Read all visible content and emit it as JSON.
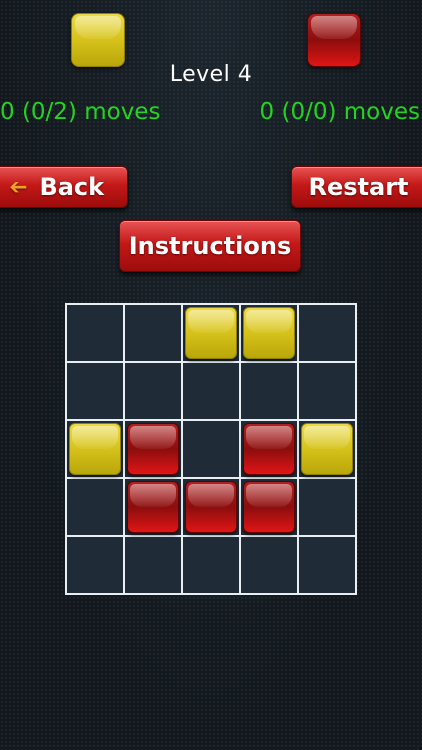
{
  "players": {
    "yellow_color": "#d6c21a",
    "red_color": "#b01212",
    "yellow_moves": "0 (0/2) moves",
    "red_moves": "0 (0/0) moves"
  },
  "level": "Level 4",
  "buttons": {
    "back": "Back",
    "back_icon": "left-arrow-icon",
    "restart": "Restart",
    "instructions": "Instructions"
  },
  "board": {
    "rows": 5,
    "cols": 5,
    "cells": [
      [
        "",
        "",
        "yellow",
        "yellow",
        ""
      ],
      [
        "",
        "",
        "",
        "",
        ""
      ],
      [
        "yellow",
        "red",
        "",
        "red",
        "yellow"
      ],
      [
        "",
        "red",
        "red",
        "red",
        ""
      ],
      [
        "",
        "",
        "",
        "",
        ""
      ]
    ]
  }
}
